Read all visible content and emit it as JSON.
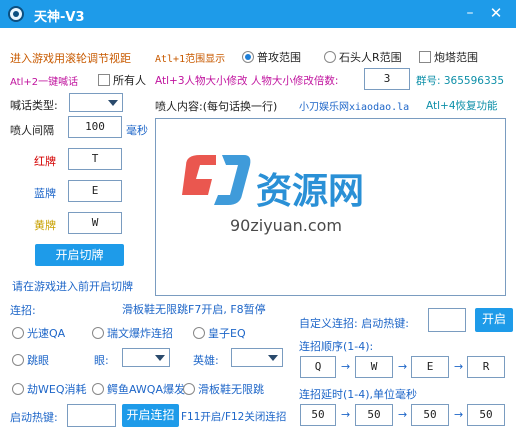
{
  "window": {
    "title": "天神-V3",
    "minimize_glyph": "–",
    "close_glyph": "✕"
  },
  "top": {
    "scroll_hint": "进入游戏用滚轮调节视距",
    "alt1_label": "Atl+1范围显示",
    "radio_normal": "普攻范围",
    "radio_stone": "石头人R范围",
    "check_tower": "炮塔范围",
    "alt2_label": "Atl+2一键喊话",
    "check_all": "所有人",
    "alt3_label": "Atl+3人物大小修改 人物大小修改倍数:",
    "scale_value": "3",
    "group_label": "群号: 365596335"
  },
  "shout": {
    "type_label": "喊话类型:",
    "content_label": "喷人内容:(每句话换一行)",
    "site_text": "小刀娱乐网xiaodao.la",
    "alt4_label": "Atl+4恢复功能",
    "interval_label": "喷人间隔",
    "interval_value": "100",
    "ms_label": "毫秒",
    "watermark_cn": "资源网",
    "watermark_url": "90ziyuan.com"
  },
  "cards": {
    "red_label": "红牌",
    "red_key": "T",
    "blue_label": "蓝牌",
    "blue_key": "E",
    "yellow_label": "黄牌",
    "yellow_key": "W",
    "switch_button": "开启切牌",
    "hint": "请在游戏进入前开启切牌"
  },
  "combo": {
    "section_label": "连招:",
    "skateboard_label": "滑板鞋无限跳F7开启, F8暂停",
    "opt_guangsu": "光速QA",
    "opt_ruiwen": "瑞文爆炸连招",
    "opt_huangzi": "皇子EQ",
    "opt_tiaoyan": "跳眼",
    "eye_label": "眼:",
    "hero_label": "英雄:",
    "opt_jiewe": "劫WEQ消耗",
    "opt_eyu": "鳄鱼AWQA爆发",
    "opt_huaban": "滑板鞋无限跳",
    "hotkey_label": "启动热键:",
    "start_button": "开启连招",
    "f11_label": "F11开启/F12关闭连招"
  },
  "custom": {
    "label": "自定义连招: 启动热键:",
    "start_button": "开启",
    "order_label": "连招顺序(1-4):",
    "order_keys": [
      "Q",
      "W",
      "E",
      "R"
    ],
    "delay_label": "连招延时(1-4),单位毫秒",
    "delay_values": [
      "50",
      "50",
      "50",
      "50"
    ],
    "arrow_glyph": "→"
  },
  "colors": {
    "title_bar": "#1e9be9",
    "button": "#1e9be9",
    "orange_text": "#c85a00",
    "magenta_text": "#c0139e",
    "blue_text": "#1e66c8",
    "watermark_red": "#e8453c",
    "watermark_blue": "#2a90d6"
  }
}
